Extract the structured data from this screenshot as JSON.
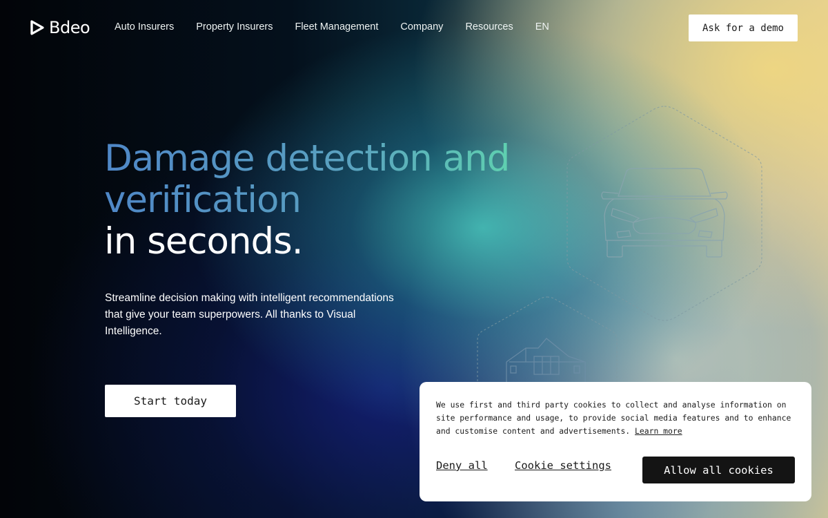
{
  "brand": {
    "name": "Bdeo"
  },
  "nav": {
    "links": [
      "Auto Insurers",
      "Property Insurers",
      "Fleet Management",
      "Company",
      "Resources",
      "EN"
    ],
    "demo_label": "Ask for a demo"
  },
  "hero": {
    "title_line1": "Damage detection and",
    "title_line2": "verification",
    "title_line3": "in seconds.",
    "subtitle": "Streamline decision making with intelligent recommendations that give your team superpowers. All thanks to Visual Intelligence.",
    "cta_label": "Start today"
  },
  "illustrations": {
    "car_icon": "car-outline-icon",
    "house_icon": "house-outline-icon"
  },
  "cookie": {
    "text": "We use first and third party cookies to collect and analyse information on site performance and usage, to provide social media features and to enhance and customise content and advertisements.",
    "learn_more": "Learn more",
    "deny_label": "Deny all",
    "settings_label": "Cookie settings",
    "allow_label": "Allow all cookies"
  },
  "colors": {
    "title_gradient_start": "#4f87c7",
    "title_gradient_end": "#5fd0b0",
    "button_bg": "#ffffff",
    "cookie_button_bg": "#141414"
  }
}
